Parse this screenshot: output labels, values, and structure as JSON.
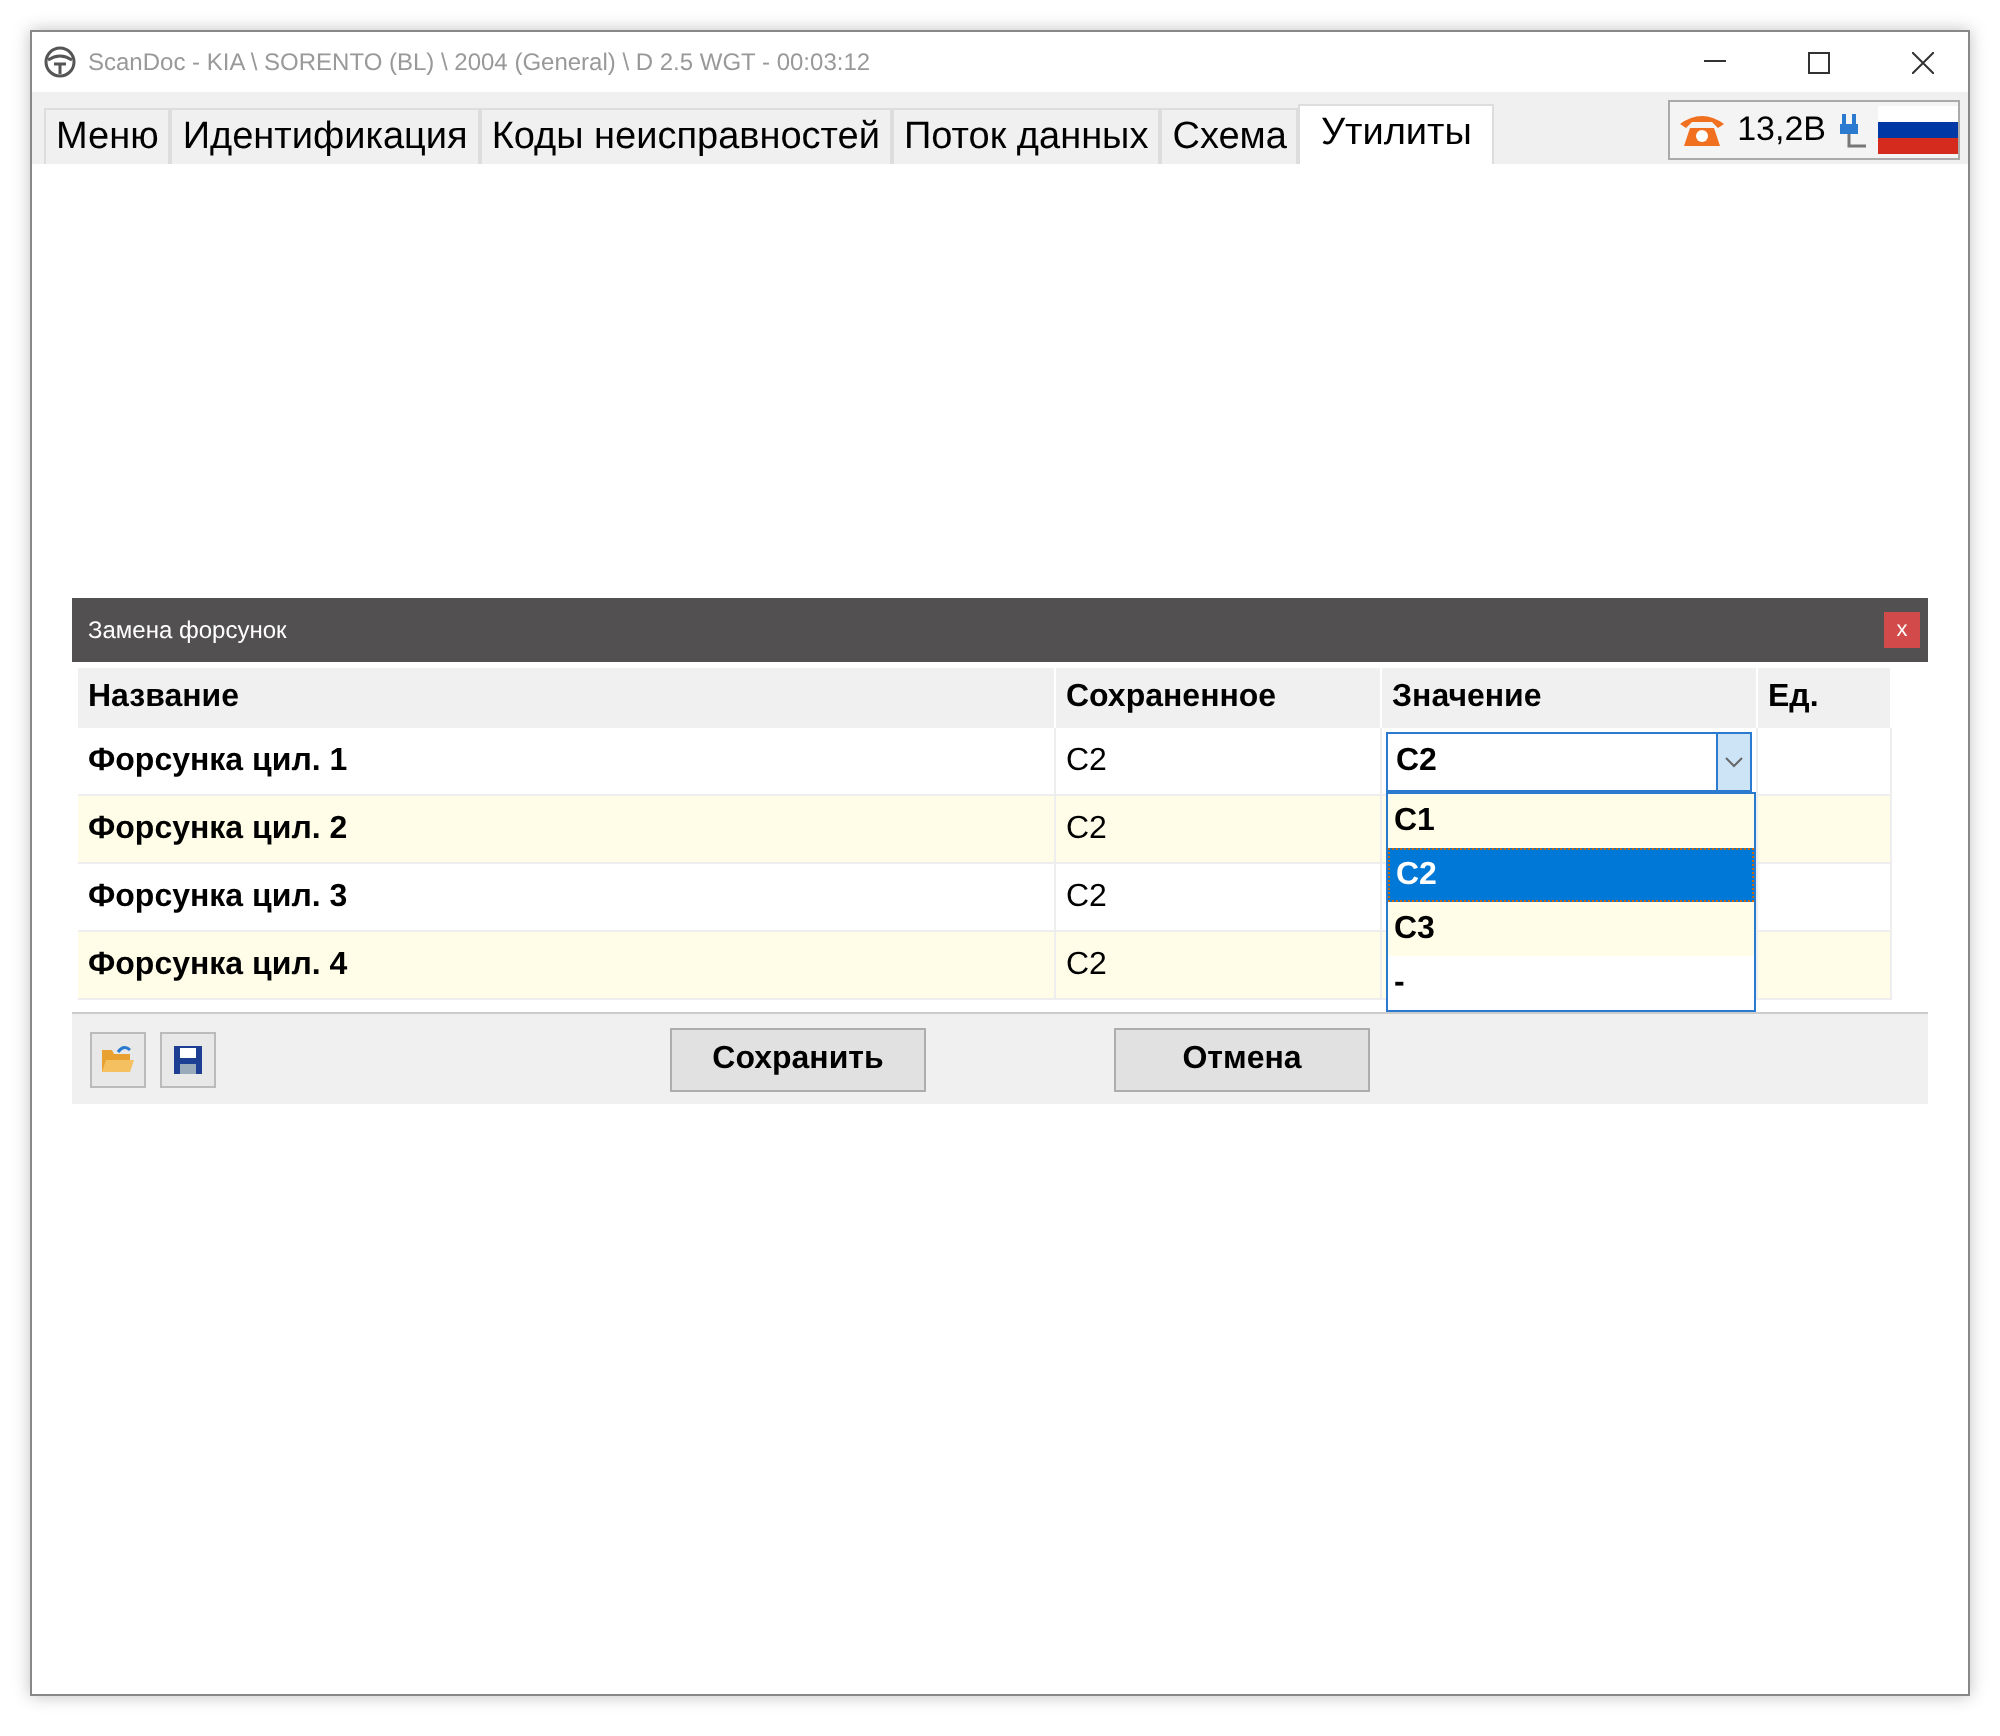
{
  "window": {
    "title": "ScanDoc - KIA \\ SORENTO (BL) \\ 2004 (General) \\ D 2.5 WGT - 00:03:12"
  },
  "tabs": [
    {
      "label": "Меню",
      "selected": false
    },
    {
      "label": "Идентификация",
      "selected": false
    },
    {
      "label": "Коды неисправностей",
      "selected": false
    },
    {
      "label": "Поток данных",
      "selected": false
    },
    {
      "label": "Схема",
      "selected": false
    },
    {
      "label": "Утилиты",
      "selected": true
    }
  ],
  "status": {
    "voltage": "13,2В"
  },
  "dialog": {
    "title": "Замена форсунок",
    "close": "x",
    "columns": [
      "Название",
      "Сохраненное",
      "Значение",
      "Ед."
    ],
    "rows": [
      {
        "name": "Форсунка цил. 1",
        "saved": "C2",
        "value": "C2"
      },
      {
        "name": "Форсунка цил. 2",
        "saved": "C2"
      },
      {
        "name": "Форсунка цил. 3",
        "saved": "C2"
      },
      {
        "name": "Форсунка цил. 4",
        "saved": "C2"
      }
    ],
    "dropdown": {
      "expanded": true,
      "options": [
        {
          "label": "C1",
          "selected": false
        },
        {
          "label": "C2",
          "selected": true
        },
        {
          "label": "C3",
          "selected": false
        },
        {
          "label": "-",
          "selected": false
        }
      ]
    },
    "buttons": [
      "Сохранить",
      "Отмена"
    ]
  }
}
